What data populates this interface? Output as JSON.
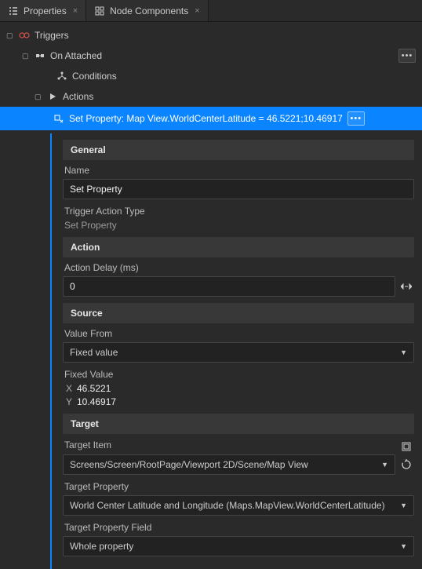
{
  "tabs": {
    "properties": "Properties",
    "node_components": "Node Components"
  },
  "tree": {
    "triggers": "Triggers",
    "on_attached": "On Attached",
    "conditions": "Conditions",
    "actions": "Actions",
    "selected": "Set Property: Map View.WorldCenterLatitude = 46.5221;10.46917"
  },
  "sections": {
    "general": "General",
    "action": "Action",
    "source": "Source",
    "target": "Target"
  },
  "fields": {
    "name_label": "Name",
    "name_value": "Set Property",
    "trigger_action_type_label": "Trigger Action Type",
    "trigger_action_type_value": "Set Property",
    "action_delay_label": "Action Delay (ms)",
    "action_delay_value": "0",
    "value_from_label": "Value From",
    "value_from_value": "Fixed value",
    "fixed_value_label": "Fixed Value",
    "fixed_x": "46.5221",
    "fixed_y": "10.46917",
    "target_item_label": "Target Item",
    "target_item_value": "Screens/Screen/RootPage/Viewport 2D/Scene/Map View",
    "target_property_label": "Target Property",
    "target_property_value": "World Center Latitude and Longitude (Maps.MapView.WorldCenterLatitude)",
    "target_property_field_label": "Target Property Field",
    "target_property_field_value": "Whole property"
  },
  "axis": {
    "x": "X",
    "y": "Y"
  }
}
